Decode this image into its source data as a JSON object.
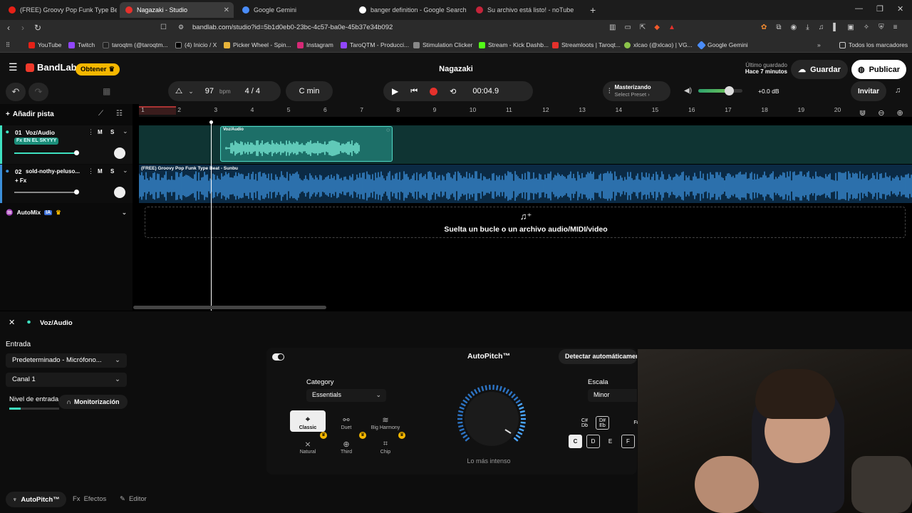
{
  "browser": {
    "tabs": [
      {
        "title": "(FREE) Groovy Pop Funk Type Beat -",
        "color": "#e62117"
      },
      {
        "title": "Nagazaki - Studio",
        "color": "#e5312c"
      },
      {
        "title": "Google Gemini",
        "color": "#4a8cf7"
      },
      {
        "title": "banger definition - Google Search",
        "color": "#ffffff"
      },
      {
        "title": "Su archivo está listo! - noTube",
        "color": "#c4243a"
      }
    ],
    "url": "bandlab.com/studio?id=5b1d0eb0-23bc-4c57-ba0e-45b37e34b092",
    "bookmarks": [
      "YouTube",
      "Twitch",
      "taroqtm (@taroqtm...",
      "(4) Inicio / X",
      "Picker Wheel - Spin...",
      "Instagram",
      "TaroQTM - Producci...",
      "Stimulation Clicker",
      "Stream - Kick Dashb...",
      "Streamloots | Taroqt...",
      "xlcao (@xlcao) | VG...",
      "Google Gemini"
    ],
    "bookmarks_all": "Todos los marcadores"
  },
  "app": {
    "brand": "BandLab",
    "get_label": "Obtener",
    "project_title": "Nagazaki",
    "last_saved_label": "Último guardado",
    "last_saved_time": "Hace 7 minutos",
    "save_label": "Guardar",
    "publish_label": "Publicar",
    "invite_label": "Invitar"
  },
  "transport": {
    "bpm": "97",
    "bpm_unit": "bpm",
    "time_sig": "4 / 4",
    "key": "C min",
    "time": "00:04.9",
    "mastering_label": "Masterizando",
    "preset_label": "Select Preset ›",
    "volume_db": "+0.0 dB",
    "volume_level": 0.7
  },
  "tracks_panel": {
    "add_track": "Añadir pista",
    "tracks": [
      {
        "index": "01",
        "name": "Voz/Audio",
        "fx": "Fx EN EL SKYYY",
        "m": "M",
        "s": "S"
      },
      {
        "index": "02",
        "name": "sold-nothy-peluso...",
        "fx": "+ Fx",
        "m": "M",
        "s": "S"
      }
    ],
    "automix": "AutoMix",
    "automix_badge": "IA"
  },
  "timeline": {
    "bars": [
      "1",
      "2",
      "3",
      "4",
      "5",
      "6",
      "7",
      "8",
      "9",
      "10",
      "11",
      "12",
      "13",
      "14",
      "15",
      "16",
      "17",
      "18",
      "19",
      "20"
    ],
    "region1": "Voz/Audio",
    "region2": "(FREE) Groovy Pop Funk Type Beat - Sunbu",
    "drop_text": "Suelta un bucle o un archivo audio/MIDI/video"
  },
  "bottom": {
    "track_name": "Voz/Audio",
    "input_label": "Entrada",
    "input_device": "Predeterminado - Micrófono...",
    "channel": "Canal 1",
    "level_label": "Nivel de entrada",
    "monitor_label": "Monitorización",
    "autopitch_title": "AutoPitch™",
    "detect_label": "Detectar automáticamente la clave",
    "category_label": "Category",
    "category_value": "Essentials",
    "styles": [
      "Classic",
      "Duet",
      "Big Harmony",
      "Natural",
      "Third",
      "Chip"
    ],
    "knob_label": "Lo más intenso",
    "scale_label": "Escala",
    "scale_value": "Minor",
    "sharp_keys": [
      "C#",
      "D#",
      "F#"
    ],
    "flat_keys": [
      "Db",
      "Eb"
    ],
    "keys": [
      "C",
      "D",
      "E",
      "F"
    ],
    "bottom_tabs": [
      "AutoPitch™",
      "Efectos",
      "Editor"
    ]
  }
}
